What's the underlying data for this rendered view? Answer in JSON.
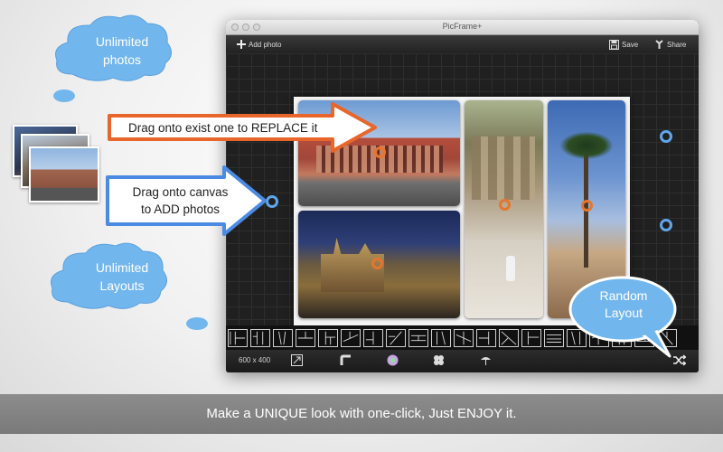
{
  "window": {
    "title": "PicFrame+"
  },
  "toolbar": {
    "add_photo_label": "Add photo",
    "save_label": "Save",
    "share_label": "Share"
  },
  "bottom_bar": {
    "canvas_size": "600 x 400"
  },
  "callouts": {
    "unlimited_photos": [
      "Unlimited",
      "photos"
    ],
    "unlimited_layouts": [
      "Unlimited",
      "Layouts"
    ],
    "replace_arrow": "Drag onto exist one to REPLACE it",
    "add_arrow": [
      "Drag onto canvas",
      "to ADD photos"
    ],
    "random_layout": [
      "Random",
      "Layout"
    ]
  },
  "banner": {
    "text": "Make a UNIQUE look with one-click, Just ENJOY it."
  },
  "colors": {
    "cloud_blue": "#6fb5ee",
    "handle_orange": "#e7752c",
    "handle_blue": "#5fa6ec",
    "arrow_orange": "#e8662a",
    "arrow_blue": "#4b8be3"
  },
  "icons": {
    "add": "plus-icon",
    "save": "floppy-disk-icon",
    "share": "share-icon",
    "resize": "resize-icon",
    "corner": "corner-radius-icon",
    "color": "color-wheel-icon",
    "pattern": "pattern-icon",
    "shadow": "shadow-icon",
    "shuffle": "shuffle-icon"
  }
}
